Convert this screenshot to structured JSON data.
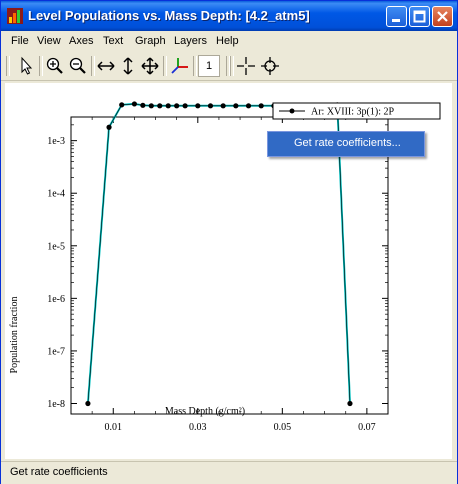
{
  "window": {
    "title": "Level Populations vs. Mass Depth: [4.2_atm5]"
  },
  "menu": {
    "items": [
      "File",
      "View",
      "Axes",
      "Text",
      "Graph",
      "Layers",
      "Help"
    ]
  },
  "toolbar": {
    "tools": [
      "pointer-icon",
      "zoom-in-icon",
      "zoom-out-icon",
      "horizontal-arrows-icon",
      "vertical-arrows-icon",
      "move-icon",
      "axes-icon",
      "layer-number",
      "crosshair-icon",
      "screen-reader-icon"
    ],
    "layer_label": "1"
  },
  "context_menu": {
    "item": "Get rate coefficients..."
  },
  "status": {
    "text": "Get rate coefficients"
  },
  "colors": {
    "line": "#00c0c0",
    "marker": "#000000",
    "highlight": "#316ac5"
  },
  "chart_data": {
    "type": "line",
    "xlabel": "Mass Depth (g/cm²)",
    "ylabel": "Population fraction",
    "xlim": [
      0.0,
      0.075
    ],
    "ylim_log10": [
      -8.2,
      -2.55
    ],
    "y_scale": "log",
    "x_ticks": [
      0.01,
      0.03,
      0.05,
      0.07
    ],
    "x_tick_labels": [
      "0.01",
      "0.03",
      "0.05",
      "0.07"
    ],
    "y_ticks_log10": [
      -8,
      -7,
      -6,
      -5,
      -4,
      -3
    ],
    "y_tick_labels": [
      "1e-8",
      "1e-7",
      "1e-6",
      "1e-5",
      "1e-4",
      "1e-3"
    ],
    "legend": {
      "placement": "top-right"
    },
    "series": [
      {
        "name": "Ar: XVIII: 3p(1): 2P",
        "x": [
          0.004,
          0.009,
          0.012,
          0.015,
          0.017,
          0.019,
          0.021,
          0.023,
          0.025,
          0.027,
          0.03,
          0.033,
          0.036,
          0.039,
          0.042,
          0.045,
          0.048,
          0.051,
          0.054,
          0.057,
          0.06,
          0.063,
          0.066
        ],
        "y": [
          1e-08,
          0.0018,
          0.0048,
          0.005,
          0.0047,
          0.0046,
          0.0046,
          0.0046,
          0.0046,
          0.0046,
          0.0046,
          0.0046,
          0.0046,
          0.0046,
          0.0046,
          0.0046,
          0.0046,
          0.0046,
          0.0046,
          0.0046,
          0.0046,
          0.0048,
          1e-08
        ]
      }
    ]
  }
}
